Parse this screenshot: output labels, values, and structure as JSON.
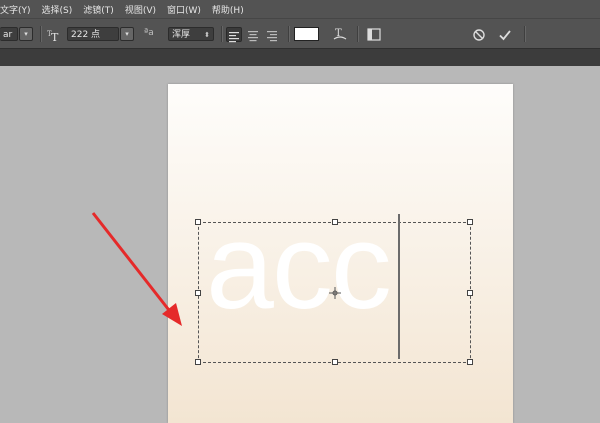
{
  "menubar": {
    "items": [
      "文字(Y)",
      "选择(S)",
      "滤镜(T)",
      "视图(V)",
      "窗口(W)",
      "帮助(H)"
    ]
  },
  "options": {
    "font_style_partial": "ar",
    "font_size": "222 点",
    "aa_label": "ªa",
    "aa_value": "浑厚",
    "text_color": "#ffffff"
  },
  "canvas": {
    "text": "acc",
    "background_top": "#fefdfb",
    "background_bottom": "#f3e5d2"
  },
  "annotation": {
    "arrow_color": "#e52a2a"
  }
}
